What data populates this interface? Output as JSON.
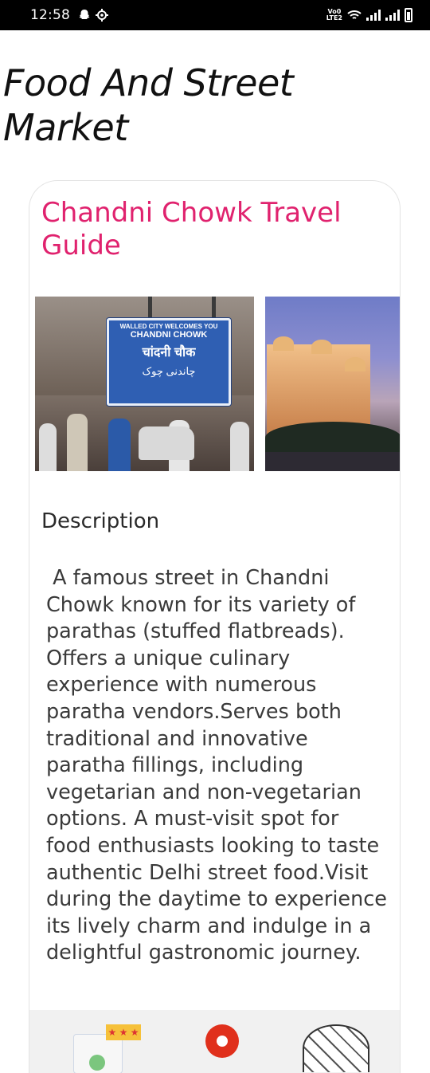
{
  "status_bar": {
    "time": "12:58",
    "volte_line1": "Vo0",
    "volte_line2": "LTE2",
    "icons": [
      "snapchat-icon",
      "settings-icon",
      "wifi-icon",
      "signal-icon",
      "battery-icon"
    ]
  },
  "page": {
    "title": "Food And Street Market"
  },
  "card": {
    "title": "Chandni Chowk Travel Guide",
    "gallery": {
      "sign_lines": [
        "WALLED CITY WELCOMES YOU",
        "CHANDNI CHOWK",
        "चांदनी चौक",
        "چاندنی چوک"
      ]
    },
    "section_heading": "Description",
    "description": " A famous street in Chandni Chowk known for its variety of parathas (stuffed flatbreads). Offers a unique culinary experience with numerous paratha vendors.Serves both traditional and innovative paratha fillings, including vegetarian and non-vegetarian options. A must-visit spot for food enthusiasts looking to taste authentic Delhi street food.Visit during the daytime to experience its lively charm and indulge in a delightful gastronomic journey.",
    "bottom_links": [
      "review-app-icon",
      "pie-chart-icon",
      "wikipedia-icon"
    ],
    "colors": {
      "title": "#e0226e",
      "card_border": "#e3e3e3",
      "bottom_bar": "#f1f1f1"
    }
  }
}
